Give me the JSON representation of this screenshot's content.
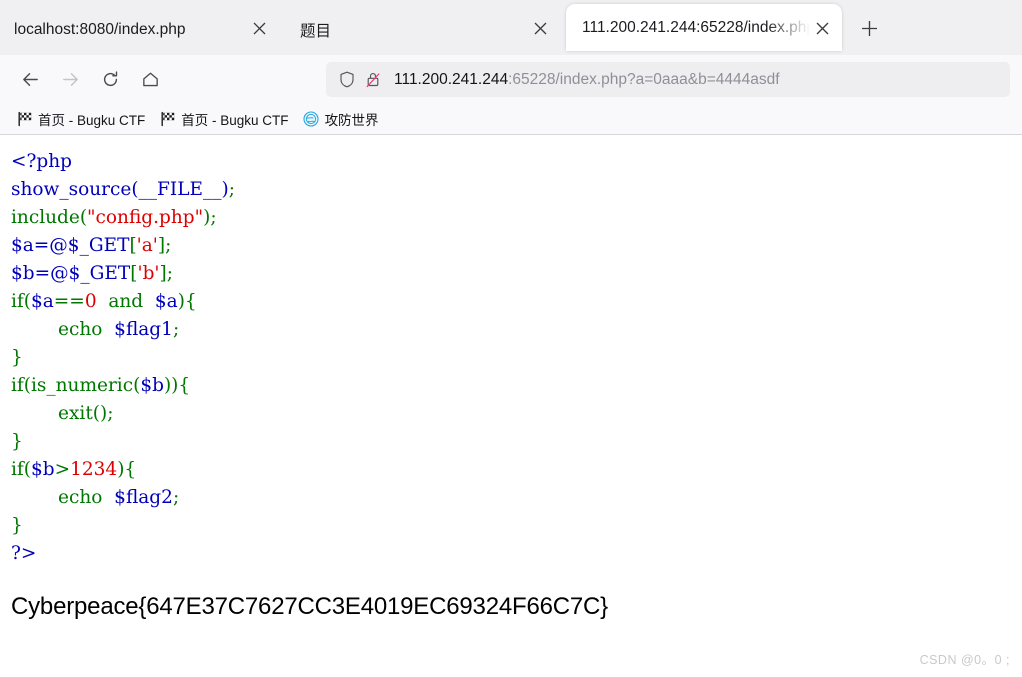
{
  "browser": {
    "tabs": [
      {
        "label": "localhost:8080/index.php",
        "active": false,
        "close_icon": "close-icon"
      },
      {
        "label": "题目",
        "active": false,
        "close_icon": "close-icon"
      },
      {
        "label": "111.200.241.244:65228/index.php",
        "active": true,
        "close_icon": "close-icon"
      }
    ],
    "new_tab_icon": "plus-icon",
    "toolbar": {
      "back_icon": "back-arrow-icon",
      "forward_icon": "forward-arrow-icon",
      "reload_icon": "reload-icon",
      "home_icon": "home-icon"
    },
    "urlbar": {
      "shield_icon": "shield-icon",
      "insecure_icon": "padlock-crossed-icon",
      "host": "111.200.241.244",
      "rest": ":65228/index.php?a=0aaa&b=4444asdf",
      "full_url": "111.200.241.244:65228/index.php?a=0aaa&b=4444asdf"
    },
    "bookmarks": [
      {
        "label": "首页 - Bugku CTF",
        "icon": "checkered-flag-icon"
      },
      {
        "label": "首页 - Bugku CTF",
        "icon": "checkered-flag-icon"
      },
      {
        "label": "攻防世界",
        "icon": "globe-blue-icon"
      }
    ]
  },
  "page": {
    "code_lines": [
      [
        {
          "t": "<?php",
          "c": "c-tag"
        }
      ],
      [
        {
          "t": "show_source",
          "c": "c-var"
        },
        {
          "t": "(__FILE__)",
          "c": "c-var"
        },
        {
          "t": ";",
          "c": "c-kw"
        }
      ],
      [
        {
          "t": "include",
          "c": "c-kw"
        },
        {
          "t": "(",
          "c": "c-kw"
        },
        {
          "t": "\"config.php\"",
          "c": "c-str"
        },
        {
          "t": ");",
          "c": "c-kw"
        }
      ],
      [
        {
          "t": "$a=@$_GET",
          "c": "c-var"
        },
        {
          "t": "[",
          "c": "c-kw"
        },
        {
          "t": "'a'",
          "c": "c-str"
        },
        {
          "t": "];",
          "c": "c-kw"
        }
      ],
      [
        {
          "t": "$b=@$_GET",
          "c": "c-var"
        },
        {
          "t": "[",
          "c": "c-kw"
        },
        {
          "t": "'b'",
          "c": "c-str"
        },
        {
          "t": "];",
          "c": "c-kw"
        }
      ],
      [
        {
          "t": "if(",
          "c": "c-kw"
        },
        {
          "t": "$a",
          "c": "c-var"
        },
        {
          "t": "==",
          "c": "c-kw"
        },
        {
          "t": "0",
          "c": "c-str"
        },
        {
          "t": "  and  ",
          "c": "c-kw"
        },
        {
          "t": "$a",
          "c": "c-var"
        },
        {
          "t": "){",
          "c": "c-kw"
        }
      ],
      [
        {
          "t": "        echo  ",
          "c": "c-kw"
        },
        {
          "t": "$flag1",
          "c": "c-var"
        },
        {
          "t": ";",
          "c": "c-kw"
        }
      ],
      [
        {
          "t": "}",
          "c": "c-kw"
        }
      ],
      [
        {
          "t": "if(is_numeric(",
          "c": "c-kw"
        },
        {
          "t": "$b",
          "c": "c-var"
        },
        {
          "t": ")){",
          "c": "c-kw"
        }
      ],
      [
        {
          "t": "        exit();",
          "c": "c-kw"
        }
      ],
      [
        {
          "t": "}",
          "c": "c-kw"
        }
      ],
      [
        {
          "t": "if(",
          "c": "c-kw"
        },
        {
          "t": "$b",
          "c": "c-var"
        },
        {
          "t": ">",
          "c": "c-kw"
        },
        {
          "t": "1234",
          "c": "c-str"
        },
        {
          "t": "){",
          "c": "c-kw"
        }
      ],
      [
        {
          "t": "        echo  ",
          "c": "c-kw"
        },
        {
          "t": "$flag2",
          "c": "c-var"
        },
        {
          "t": ";",
          "c": "c-kw"
        }
      ],
      [
        {
          "t": "}",
          "c": "c-kw"
        }
      ],
      [
        {
          "t": "?>",
          "c": "c-tag"
        }
      ]
    ],
    "flag": "Cyberpeace{647E37C7627CC3E4019EC69324F66C7C}",
    "watermark": "CSDN @0。0 ;"
  },
  "colors": {
    "php_keyword": "#007700",
    "php_variable": "#0000bb",
    "php_string": "#dd0000",
    "chrome_bg": "#f0f0f2",
    "toolbar_bg": "#f9f9fb",
    "urlbar_bg": "#eeeef1"
  }
}
